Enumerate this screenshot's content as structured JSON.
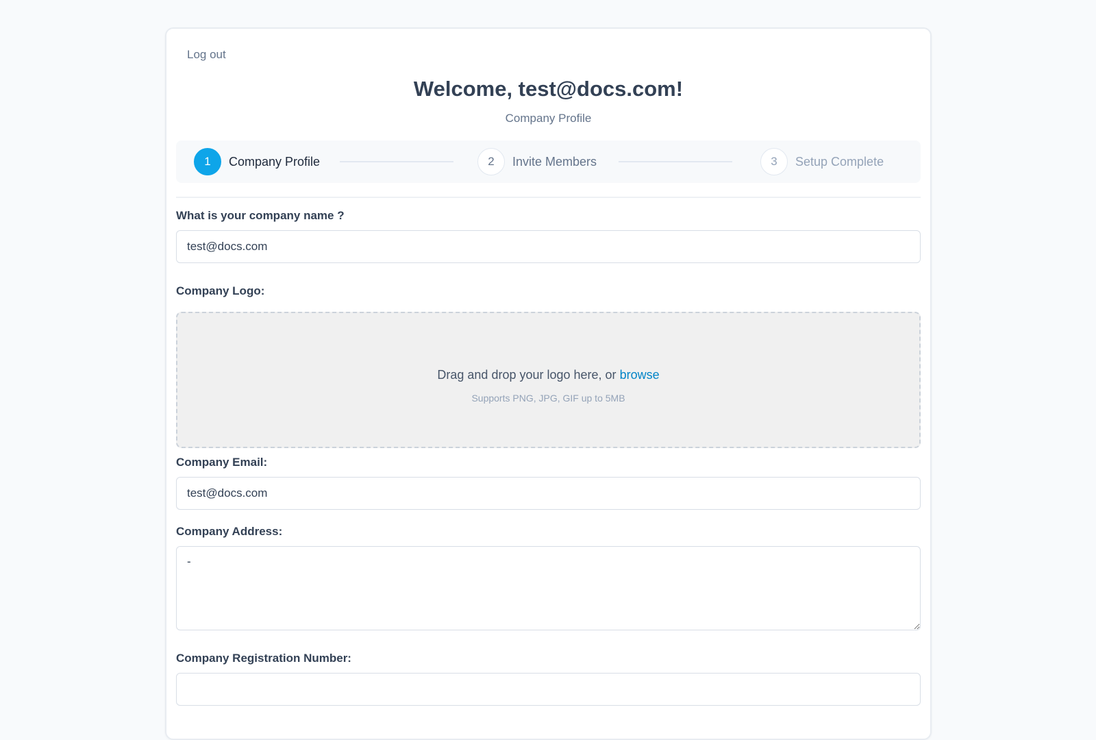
{
  "header": {
    "logout_label": "Log out",
    "title": "Welcome, test@docs.com!",
    "subtitle": "Company Profile"
  },
  "steps": [
    {
      "number": "1",
      "label": "Company Profile",
      "state": "active"
    },
    {
      "number": "2",
      "label": "Invite Members",
      "state": "pending"
    },
    {
      "number": "3",
      "label": "Setup Complete",
      "state": "future"
    }
  ],
  "form": {
    "company_name": {
      "label": "What is your company name ?",
      "value": "test@docs.com"
    },
    "logo": {
      "label": "Company Logo:",
      "drop_text": "Drag and drop your logo here, or",
      "browse_label": "browse",
      "hint": "Supports PNG, JPG, GIF up to 5MB"
    },
    "email": {
      "label": "Company Email:",
      "value": "test@docs.com"
    },
    "address": {
      "label": "Company Address:",
      "value": "-"
    },
    "registration": {
      "label": "Company Registration Number:",
      "value": ""
    }
  },
  "colors": {
    "accent": "#0ea5e9",
    "link": "#0284c7"
  }
}
